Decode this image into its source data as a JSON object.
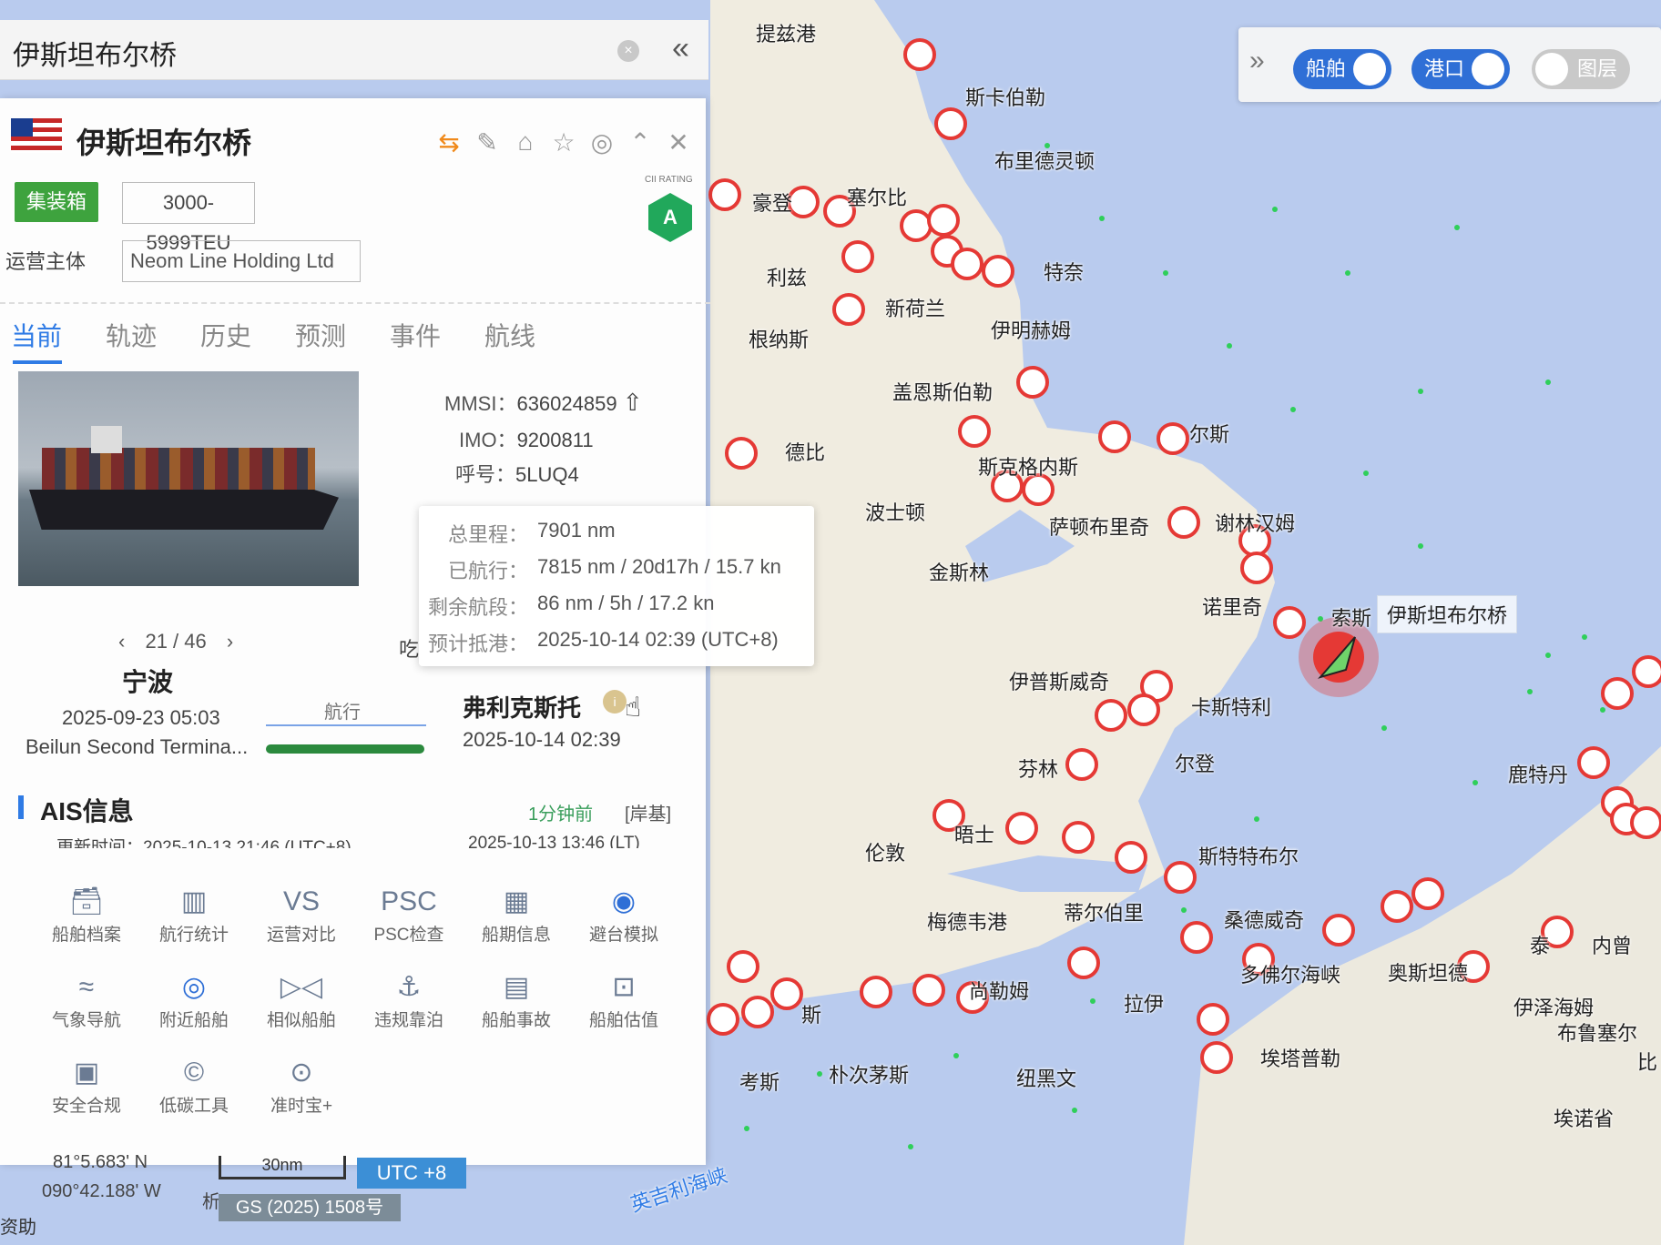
{
  "search": {
    "query": "伊斯坦布尔桥",
    "clear_icon": "close-circle-icon",
    "collapse_icon": "double-chevron-left-icon"
  },
  "vessel": {
    "name": "伊斯坦布尔桥",
    "flag_icon": "liberia-flag-icon",
    "type_tag": "集装箱",
    "teu_tag": "3000-5999TEU",
    "operator_label": "运营主体",
    "operator_value": "Neom Line Holding Ltd",
    "cii_label": "CII RATING",
    "cii_grade": "A",
    "cii_color": "#21a85b"
  },
  "header_tools": [
    "share-icon",
    "edit-icon",
    "tag-icon",
    "star-icon",
    "locate-icon",
    "chevron-up-icon",
    "close-icon"
  ],
  "tabs": [
    "当前",
    "轨迹",
    "历史",
    "预测",
    "事件",
    "航线"
  ],
  "ids": {
    "mmsi_label": "MMSI：",
    "mmsi": "636024859",
    "imo_label": "IMO：",
    "imo": "9200811",
    "call_label": "呼号：",
    "call": "5LUQ4"
  },
  "voyage": {
    "pager": "21 / 46",
    "from_port": "宁波",
    "from_time": "2025-09-23 05:03",
    "from_terminal": "Beilun Second Termina...",
    "state": "航行",
    "to_port": "弗利克斯托",
    "to_time": "2025-10-14 02:39",
    "progress": 0.99,
    "eat_label": "吃"
  },
  "tooltip": {
    "rows": [
      {
        "k": "总里程：",
        "v": "7901 nm"
      },
      {
        "k": "已航行：",
        "v": "7815 nm / 20d17h / 15.7 kn"
      },
      {
        "k": "剩余航段：",
        "v": "86 nm / 5h / 17.2 kn"
      },
      {
        "k": "预计抵港：",
        "v": "2025-10-14 02:39 (UTC+8)"
      }
    ]
  },
  "ais": {
    "title": "AIS信息",
    "ago": "1分钟前",
    "source": "[岸基]",
    "update_label": "更新时间：2025-10-13 21:46 (UTC+8)",
    "update_local": "2025-10-13 13:46 (LT)"
  },
  "tools": [
    {
      "label": "船舶档案",
      "icon": "archive-icon"
    },
    {
      "label": "航行统计",
      "icon": "bar-chart-icon"
    },
    {
      "label": "运营对比",
      "icon": "vs-icon"
    },
    {
      "label": "PSC检查",
      "icon": "psc-icon"
    },
    {
      "label": "船期信息",
      "icon": "calendar-icon"
    },
    {
      "label": "避台模拟",
      "icon": "typhoon-icon"
    },
    {
      "label": "气象导航",
      "icon": "weather-nav-icon"
    },
    {
      "label": "附近船舶",
      "icon": "nearby-icon"
    },
    {
      "label": "相似船舶",
      "icon": "similar-ship-icon"
    },
    {
      "label": "违规靠泊",
      "icon": "anchor-icon"
    },
    {
      "label": "船舶事故",
      "icon": "accident-icon"
    },
    {
      "label": "船舶估值",
      "icon": "valuation-icon"
    },
    {
      "label": "安全合规",
      "icon": "compliance-icon"
    },
    {
      "label": "低碳工具",
      "icon": "low-carbon-icon"
    },
    {
      "label": "准时宝+",
      "icon": "ontime-icon"
    }
  ],
  "map_controls": {
    "expand_icon": "double-chevron-right-icon",
    "ships": "船舶",
    "ports": "港口",
    "layers": "图层",
    "on_color": "#2f6fd6"
  },
  "map_labels": [
    "提兹港",
    "斯卡伯勒",
    "布里德灵顿",
    "豪登",
    "塞尔比",
    "利兹",
    "特奈",
    "新荷兰",
    "伊明赫姆",
    "根纳斯",
    "盖恩斯伯勒",
    "德比",
    "斯克格内斯",
    "尔斯",
    "波士顿",
    "萨顿布里奇",
    "谢林汉姆",
    "金斯林",
    "诺里奇",
    "索斯",
    "伊普斯威奇",
    "伊斯坦布尔桥",
    "卡斯特利",
    "芬林",
    "尔登",
    "伦敦",
    "晤士",
    "斯特特布尔",
    "梅德韦港",
    "蒂尔伯里",
    "桑德威奇",
    "鹿特丹",
    "泰",
    "内曾",
    "奥斯坦德",
    "多佛尔海峡",
    "伊泽海姆",
    "布鲁塞尔",
    "比",
    "拉伊",
    "埃塔普勒",
    "埃诺省",
    "纽黑文",
    "朴次茅斯",
    "考斯",
    "斯",
    "尚勒姆",
    "英吉利海峡"
  ],
  "bottom": {
    "lat": "81°5.683' N",
    "lon": "090°42.188' W",
    "scale": "30nm",
    "utc": "UTC +8",
    "gs": "GS (2025) 1508号",
    "bz": "析",
    "zz": "资助"
  }
}
